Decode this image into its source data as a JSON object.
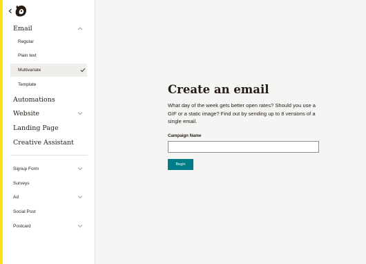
{
  "colors": {
    "accent": "#ffe01b",
    "button": "#007c89",
    "selected_bg": "#efeeea"
  },
  "icons": {
    "back": "chevron-left-icon",
    "logo": "freddie-logo-icon",
    "expand": "chevron-down-icon",
    "collapse": "chevron-up-icon",
    "selected": "checkmark-icon"
  },
  "sidebar": {
    "email": {
      "label": "Email",
      "expanded": true
    },
    "email_items": [
      {
        "label": "Regular"
      },
      {
        "label": "Plain text"
      },
      {
        "label": "Multivariate",
        "selected": true
      },
      {
        "label": "Template"
      }
    ],
    "automations": {
      "label": "Automations"
    },
    "website": {
      "label": "Website"
    },
    "landing_page": {
      "label": "Landing Page"
    },
    "creative_assistant": {
      "label": "Creative Assistant"
    },
    "secondary": [
      {
        "label": "Signup Form"
      },
      {
        "label": "Surveys"
      },
      {
        "label": "Ad"
      },
      {
        "label": "Social Post"
      },
      {
        "label": "Postcard"
      }
    ]
  },
  "main": {
    "title": "Create an email",
    "description": "What day of the week gets better open rates? Should you use a GIF or a static image? Find out by sending up to 8 versions of a single email.",
    "campaign_label": "Campaign Name",
    "campaign_value": "",
    "begin_label": "Begin"
  }
}
